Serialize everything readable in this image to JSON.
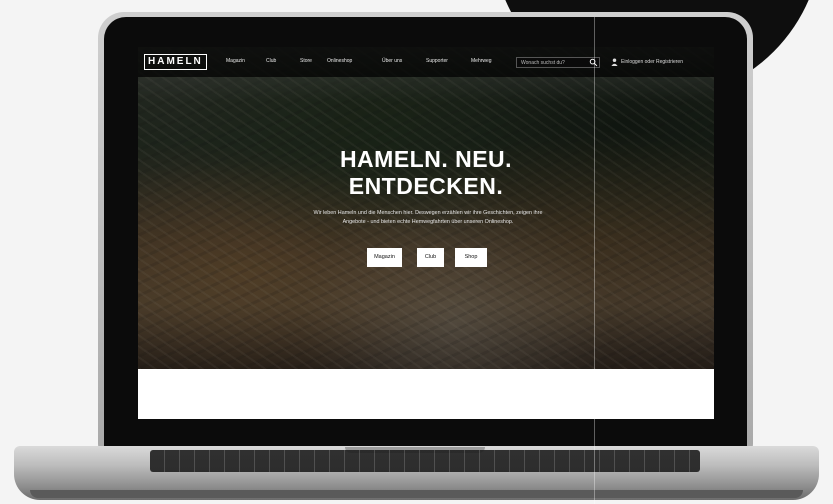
{
  "nav": {
    "logo": "HAMELN",
    "items": [
      "Magazin",
      "Club",
      "Store",
      "Onlineshop",
      "Über uns",
      "Supporter",
      "Mehrweg"
    ],
    "search_placeholder": "Wonach suchst du?",
    "login": "Einloggen oder Registrieren"
  },
  "hero": {
    "headline_line1": "HAMELN. NEU.",
    "headline_line2": "ENTDECKEN.",
    "subtext": "Wir leben Hameln und die Menschen hier. Deswegen erzählen wir ihre Geschichten, zeigen ihre Angebote - und bieten echte Hemwegfahrten über unseren Onlineshop.",
    "buttons": [
      "Magazin",
      "Club",
      "Shop"
    ]
  },
  "colors": {
    "nav_bg": "#000000",
    "button_bg": "#ffffff",
    "headline": "#ffffff"
  }
}
